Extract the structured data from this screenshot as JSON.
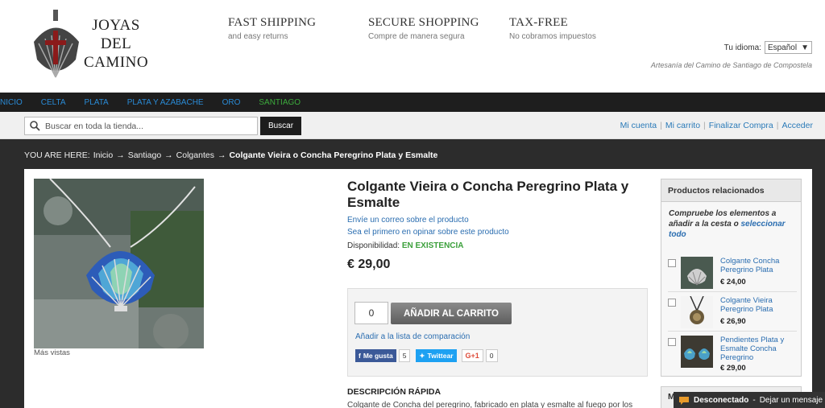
{
  "header": {
    "logo_line1": "JOYAS",
    "logo_line2": "DEL",
    "logo_line3": "CAMINO",
    "features": [
      {
        "title": "FAST SHIPPING",
        "subtitle": "and easy returns"
      },
      {
        "title": "SECURE SHOPPING",
        "subtitle": "Compre de manera segura"
      },
      {
        "title": "TAX-FREE",
        "subtitle": "No cobramos impuestos"
      }
    ],
    "language_label": "Tu idioma:",
    "language_value": "Español",
    "tagline": "Artesanía del Camino de Santiago de Compostela"
  },
  "nav": {
    "items": [
      "NICIO",
      "CELTA",
      "PLATA",
      "PLATA Y AZABACHE",
      "ORO",
      "SANTIAGO"
    ]
  },
  "search": {
    "placeholder": "Buscar en toda la tienda...",
    "button": "Buscar"
  },
  "account": {
    "links": [
      "Mi cuenta",
      "Mi carrito",
      "Finalizar Compra",
      "Acceder"
    ]
  },
  "breadcrumb": {
    "prefix": "YOU ARE HERE:",
    "items": [
      "Inicio",
      "Santiago",
      "Colgantes"
    ],
    "separator": "→",
    "current": "Colgante Vieira o Concha Peregrino Plata y Esmalte"
  },
  "product": {
    "title": "Colgante Vieira o Concha Peregrino Plata y Esmalte",
    "email_link": "Envíe un correo sobre el producto",
    "review_link": "Sea el primero en opinar sobre este producto",
    "availability_label": "Disponibilidad:",
    "availability_value": "EN EXISTENCIA",
    "price": "€ 29,00",
    "qty": "0",
    "add_to_cart": "AÑADIR AL CARRITO",
    "compare_link": "Añadir a la lista de comparación",
    "more_views": "Más vistas",
    "social": {
      "fb_label": "Me gusta",
      "fb_count": "5",
      "tw_label": "Twittear",
      "gp_label": "G+1",
      "gp_count": "0"
    },
    "desc_title": "DESCRIPCIÓN RÁPIDA",
    "desc_text": "Colgante de Concha del peregrino, fabricado en plata y esmalte al fuego por los"
  },
  "related": {
    "title": "Productos relacionados",
    "note_prefix": "Compruebe los elementos a añadir a la cesta o",
    "note_link": "seleccionar todo",
    "items": [
      {
        "name": "Colgante Concha Peregrino Plata",
        "price": "€ 24,00"
      },
      {
        "name": "Colgante Vieira Peregrino Plata",
        "price": "€ 26,90"
      },
      {
        "name": "Pendientes Plata y Esmalte Concha Peregrino",
        "price": "€ 29,00"
      }
    ]
  },
  "mini_block_title": "M",
  "chat": {
    "status": "Desconectado",
    "sep": "-",
    "message": "Dejar un mensaje"
  },
  "colors": {
    "nav_bg": "#1e1e1e",
    "link": "#2a6db0",
    "in_stock": "#3ba03b"
  }
}
